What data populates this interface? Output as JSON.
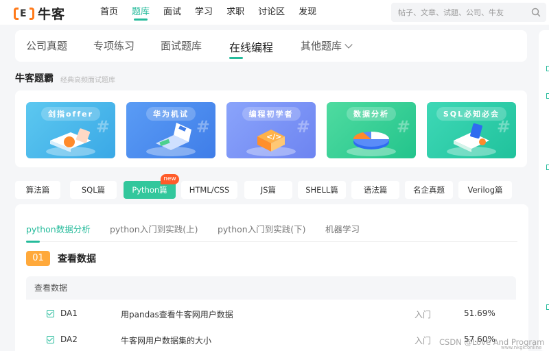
{
  "brand": {
    "name": "牛客"
  },
  "nav": [
    {
      "label": "首页",
      "active": false
    },
    {
      "label": "题库",
      "active": true
    },
    {
      "label": "面试",
      "active": false
    },
    {
      "label": "学习",
      "active": false
    },
    {
      "label": "求职",
      "active": false
    },
    {
      "label": "讨论区",
      "active": false
    },
    {
      "label": "发现",
      "active": false
    }
  ],
  "search": {
    "placeholder": "帖子、文章、试题、公司、牛友"
  },
  "tabs": [
    {
      "label": "公司真题"
    },
    {
      "label": "专项练习"
    },
    {
      "label": "面试题库"
    },
    {
      "label": "在线编程",
      "active": true
    },
    {
      "label": "其他题库"
    }
  ],
  "section": {
    "title": "牛客题霸",
    "subtitle": "经典高频面试题库"
  },
  "banners": [
    {
      "label": "剑指offer",
      "color_from": "#5cc8f0",
      "color_to": "#3aa8e6"
    },
    {
      "label": "华为机试",
      "color_from": "#5a9cf5",
      "color_to": "#3f7de8"
    },
    {
      "label": "编程初学者",
      "color_from": "#8aa4fb",
      "color_to": "#6d84f1"
    },
    {
      "label": "数据分析",
      "color_from": "#4fdba0",
      "color_to": "#23c48c"
    },
    {
      "label": "SQL必知必会",
      "color_from": "#3ed8b6",
      "color_to": "#20c29c"
    }
  ],
  "languages": [
    {
      "label": "算法篇"
    },
    {
      "label": "SQL篇"
    },
    {
      "label": "Python篇",
      "active": true
    },
    {
      "label": "HTML/CSS"
    },
    {
      "label": "JS篇"
    },
    {
      "label": "SHELL篇"
    },
    {
      "label": "语法篇"
    },
    {
      "label": "名企真题"
    },
    {
      "label": "Verilog篇"
    }
  ],
  "new_badge": "new",
  "subtabs": [
    {
      "label": "python数据分析",
      "active": true
    },
    {
      "label": "python入门到实践(上)"
    },
    {
      "label": "python入门到实践(下)"
    },
    {
      "label": "机器学习"
    }
  ],
  "chapter": {
    "number": "01",
    "title": "查看数据"
  },
  "list": {
    "header": "查看数据",
    "rows": [
      {
        "code": "DA1",
        "title": "用pandas查看牛客网用户数据",
        "level": "入门",
        "rate": "51.69%"
      },
      {
        "code": "DA2",
        "title": "牛客网用户数据集的大小",
        "level": "入门",
        "rate": "57.60%"
      }
    ]
  },
  "watermark": {
    "text": "CSDN @Love And Program",
    "sub": "www.nkgk.online"
  },
  "colors": {
    "accent": "#25bb9b",
    "orange": "#ffa93b",
    "new": "#ff5c2a"
  }
}
